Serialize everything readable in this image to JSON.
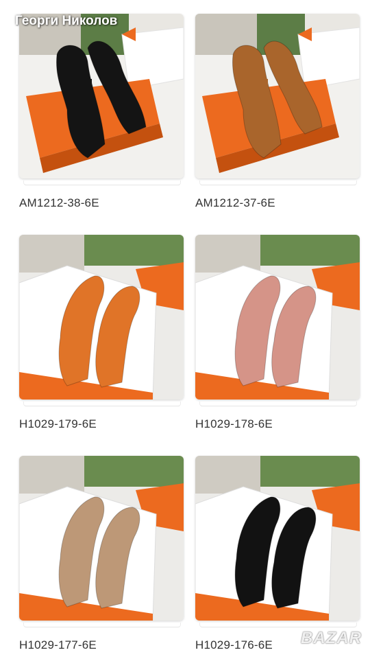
{
  "header": {
    "seller_name": "Георги Николов"
  },
  "watermark": {
    "brand": "BAZAR"
  },
  "colors": {
    "box_orange": "#ec6a1f",
    "caption_text": "#333333"
  },
  "products": [
    {
      "code": "AM1212-38-6E",
      "shoe_color": "#141414",
      "scene": "orange-box-top"
    },
    {
      "code": "AM1212-37-6E",
      "shoe_color": "#a9652c",
      "scene": "orange-box-top"
    },
    {
      "code": "H1029-179-6E",
      "shoe_color": "#e07428",
      "scene": "white-box"
    },
    {
      "code": "H1029-178-6E",
      "shoe_color": "#d59488",
      "scene": "white-box"
    },
    {
      "code": "H1029-177-6E",
      "shoe_color": "#bd9877",
      "scene": "white-box"
    },
    {
      "code": "H1029-176-6E",
      "shoe_color": "#121212",
      "scene": "white-box"
    }
  ]
}
